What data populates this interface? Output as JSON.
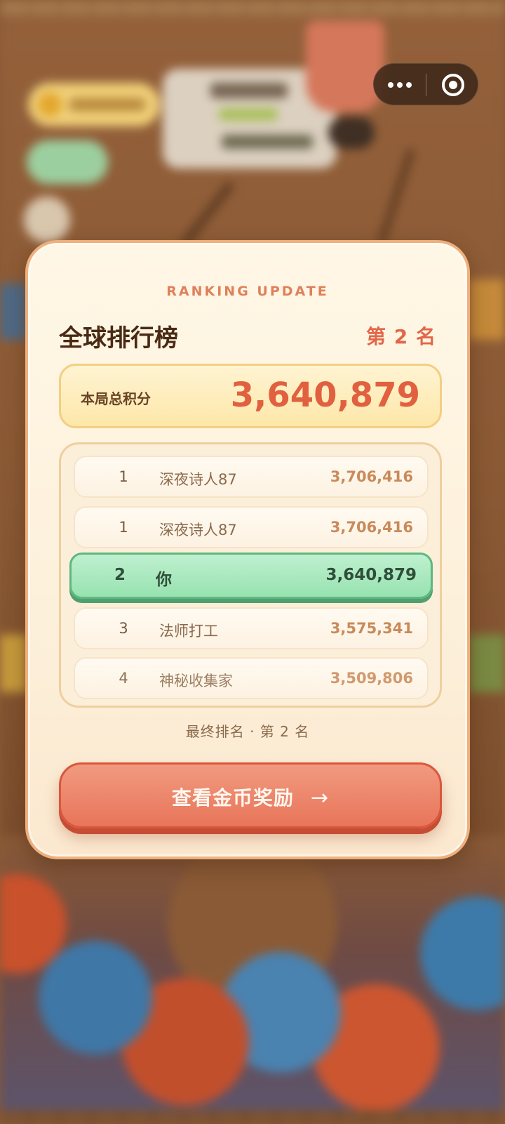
{
  "modal": {
    "kicker": "RANKING UPDATE",
    "title": "全球排行榜",
    "rank_tag": "第 2 名",
    "score_label": "本局总积分",
    "score_value": "3,640,879",
    "rows": [
      {
        "rank": "1",
        "name": "深夜诗人87",
        "score": "3,706,416"
      },
      {
        "rank": "1",
        "name": "深夜诗人87",
        "score": "3,706,416"
      },
      {
        "rank": "2",
        "name": "你",
        "score": "3,640,879"
      },
      {
        "rank": "3",
        "name": "法师打工",
        "score": "3,575,341"
      },
      {
        "rank": "4",
        "name": "神秘收集家",
        "score": "3,509,806"
      }
    ],
    "final_rank": "最终排名 · 第 2 名",
    "cta_label": "查看金币奖励",
    "cta_arrow": "→"
  },
  "capsule": {
    "more_icon": "more-dots-icon",
    "close_icon": "target-circle-icon"
  },
  "colors": {
    "accent": "#e2674a",
    "highlight_row": "#97e2b0",
    "button": "#e8755a"
  }
}
